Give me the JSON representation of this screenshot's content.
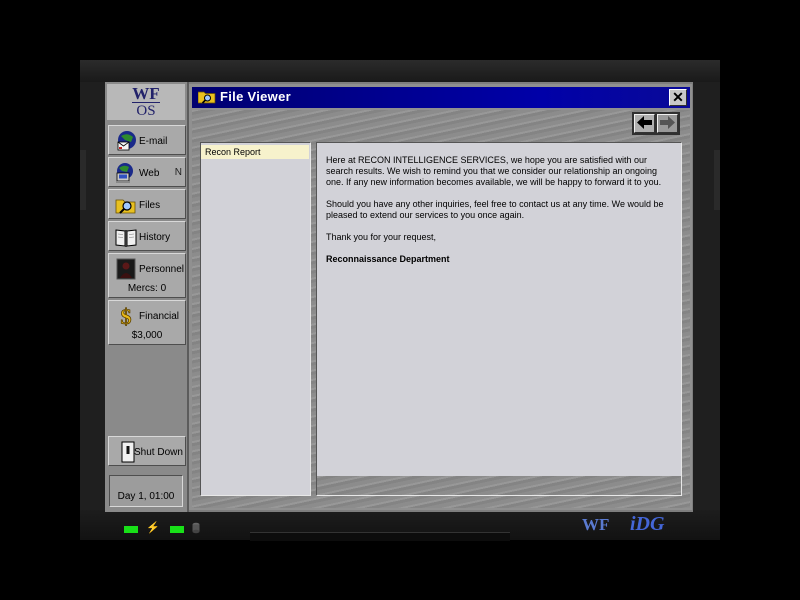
{
  "os_logo": {
    "line1": "WF",
    "line2": "OS"
  },
  "sidebar": {
    "items": [
      {
        "label": "E-mail",
        "icon": "email-globe-icon"
      },
      {
        "label": "Web",
        "icon": "web-computer-icon",
        "arrow": "N"
      },
      {
        "label": "Files",
        "icon": "folder-magnifier-icon"
      },
      {
        "label": "History",
        "icon": "book-icon"
      },
      {
        "label": "Personnel",
        "icon": "personnel-photo-icon",
        "sub": "Mercs: 0"
      },
      {
        "label": "Financial",
        "icon": "dollar-sign-icon",
        "sub": "$3,000"
      }
    ],
    "shutdown_label": "Shut Down",
    "clock": "Day 1, 01:00"
  },
  "window": {
    "title": "File Viewer",
    "close_glyph": "✕",
    "nav": {
      "back": "🡐",
      "forward": "🡒"
    }
  },
  "file_list": [
    "Recon Report"
  ],
  "document": {
    "paragraphs": [
      "Here at RECON INTELLIGENCE SERVICES, we hope you are satisfied with our search results. We wish to remind you that we consider our relationship an ongoing one. If any new information becomes available, we will be happy to forward it to you.",
      "Should you have any other inquiries, feel free to contact us at any time. We would be pleased to extend our services to you once again.",
      "Thank you for your request,"
    ],
    "signature": "Reconnaissance Department"
  },
  "branding": {
    "left": "WF",
    "right": "iDG"
  },
  "colors": {
    "titlebar": "#0000a8",
    "led": "#18e018",
    "selected_file": "#f7f2cc"
  }
}
